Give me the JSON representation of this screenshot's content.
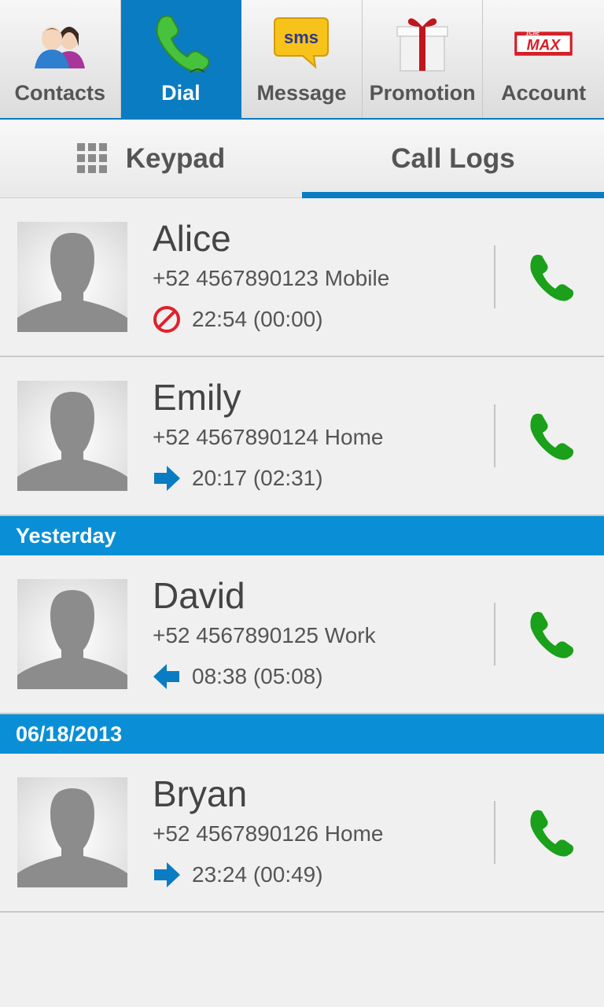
{
  "nav": {
    "items": [
      {
        "label": "Contacts",
        "icon": "contacts-icon",
        "active": false
      },
      {
        "label": "Dial",
        "icon": "phone-icon",
        "active": true
      },
      {
        "label": "Message",
        "icon": "sms-icon",
        "active": false
      },
      {
        "label": "Promotion",
        "icon": "gift-icon",
        "active": false
      },
      {
        "label": "Account",
        "icon": "max-logo-icon",
        "active": false
      }
    ],
    "sms_icon_text": "sms",
    "account_logo_text": "MAX",
    "account_logo_small": "1Clic"
  },
  "subtabs": {
    "keypad": "Keypad",
    "call_logs": "Call Logs",
    "active": "call_logs"
  },
  "groups": [
    {
      "header": "",
      "entries": [
        {
          "name": "Alice",
          "number": "+52 4567890123 Mobile",
          "time": "22:54 (00:00)",
          "status": "missed"
        },
        {
          "name": "Emily",
          "number": "+52 4567890124 Home",
          "time": "20:17 (02:31)",
          "status": "outgoing"
        }
      ]
    },
    {
      "header": "Yesterday",
      "entries": [
        {
          "name": "David",
          "number": "+52 4567890125 Work",
          "time": "08:38 (05:08)",
          "status": "incoming"
        }
      ]
    },
    {
      "header": "06/18/2013",
      "entries": [
        {
          "name": "Bryan",
          "number": "+52 4567890126 Home",
          "time": "23:24 (00:49)",
          "status": "outgoing"
        }
      ]
    }
  ],
  "colors": {
    "accent": "#0a7cc1",
    "section_header": "#0a8fd6",
    "call_green": "#1aa01a",
    "missed_red": "#e0212b",
    "arrow_blue": "#0a7cc1"
  }
}
